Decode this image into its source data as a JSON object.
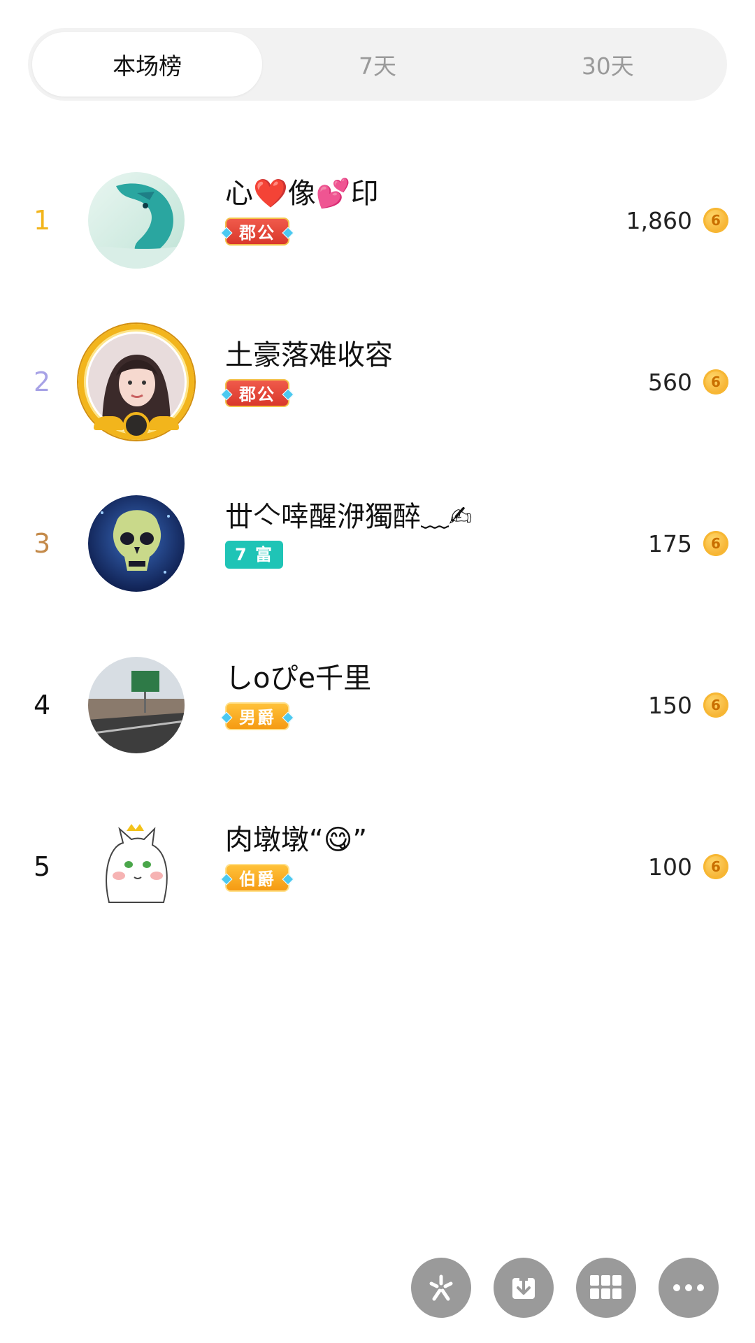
{
  "tabs": [
    {
      "label": "本场榜",
      "active": true
    },
    {
      "label": "7天",
      "active": false
    },
    {
      "label": "30天",
      "active": false
    }
  ],
  "rank_colors": {
    "1": "#f2b51c",
    "2": "#a7a2e6",
    "3": "#c48a4a",
    "4": "#111111",
    "5": "#111111"
  },
  "rows": [
    {
      "rank": "1",
      "name": "心❤️像💕印",
      "badge": "郡公",
      "badge_style": "rank-red",
      "score": "1,860",
      "coin": "6",
      "avatar": "dragon-avatar"
    },
    {
      "rank": "2",
      "name": "土豪落难收容",
      "badge": "郡公",
      "badge_style": "rank-red",
      "score": "560",
      "coin": "6",
      "avatar": "girl-avatar-gold-frame"
    },
    {
      "rank": "3",
      "name": "丗亽啈醒洢獨醉﹏✍",
      "badge": "7 富",
      "badge_style": "rich",
      "score": "175",
      "coin": "6",
      "avatar": "skull-avatar"
    },
    {
      "rank": "4",
      "name": "しoぴe千里",
      "badge": "男爵",
      "badge_style": "rank-orange",
      "score": "150",
      "coin": "6",
      "avatar": "road-avatar"
    },
    {
      "rank": "5",
      "name": "肉墩墩“😋”",
      "badge": "伯爵",
      "badge_style": "rank-orange",
      "score": "100",
      "coin": "6",
      "avatar": "cat-avatar"
    }
  ],
  "actions": [
    {
      "icon": "sparkle-icon"
    },
    {
      "icon": "download-icon"
    },
    {
      "icon": "grid-icon"
    },
    {
      "icon": "more-icon"
    }
  ]
}
